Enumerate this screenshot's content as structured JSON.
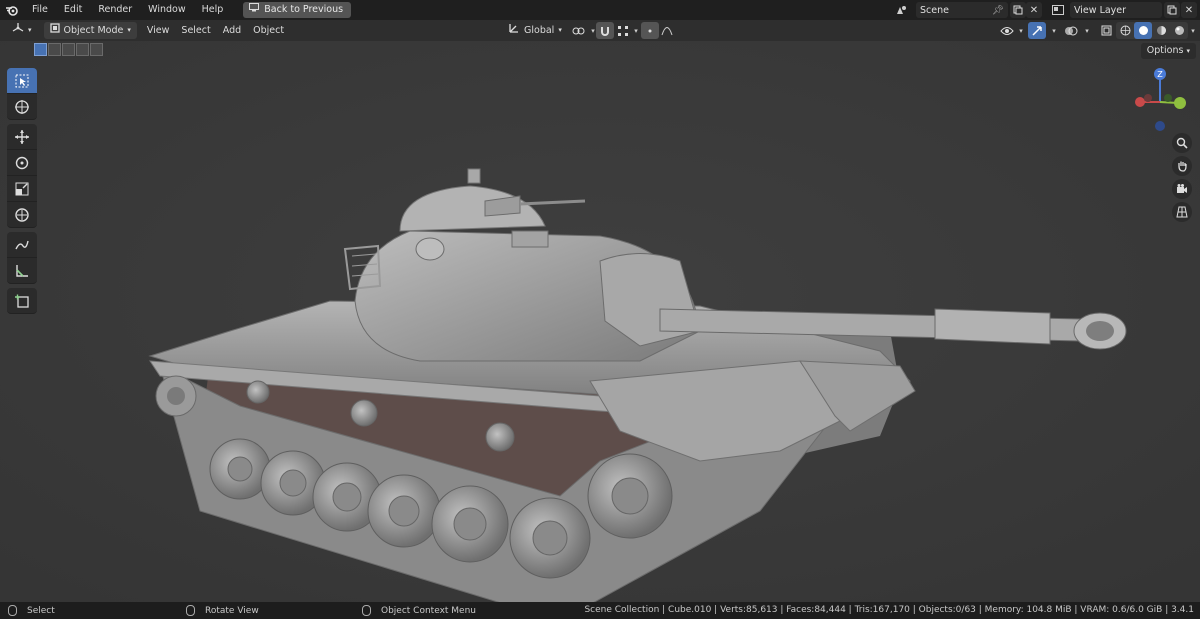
{
  "menu": {
    "items": [
      "File",
      "Edit",
      "Render",
      "Window",
      "Help"
    ],
    "back_label": "Back to Previous",
    "scene": "Scene",
    "view_layer": "View Layer"
  },
  "header": {
    "mode": "Object Mode",
    "menus": [
      "View",
      "Select",
      "Add",
      "Object"
    ],
    "orientation": "Global"
  },
  "viewport": {
    "options_label": "Options",
    "gizmo": {
      "z_label": "Z"
    },
    "tools": [
      "select-box",
      "cursor",
      "move",
      "rotate",
      "scale",
      "transform",
      "annotate",
      "measure",
      "add-cube"
    ]
  },
  "status": {
    "left_click": "Select",
    "middle_click": "Rotate View",
    "right_click": "Object Context Menu",
    "stats": "Scene Collection | Cube.010 | Verts:85,613 | Faces:84,444 | Tris:167,170 | Objects:0/63 | Memory: 104.8 MiB | VRAM: 0.6/6.0 GiB | 3.4.1"
  },
  "colors": {
    "accent": "#4772b3",
    "viewport_bg": "#393939",
    "model": "#8f8f8f"
  }
}
